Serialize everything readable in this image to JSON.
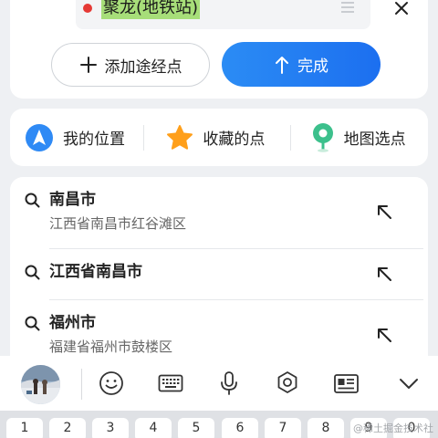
{
  "route": {
    "destination": "聚龙(地铁站)",
    "add_waypoint_label": "添加途经点",
    "done_label": "完成"
  },
  "quick_actions": [
    {
      "label": "我的位置",
      "icon": "location-arrow-icon"
    },
    {
      "label": "收藏的点",
      "icon": "star-icon"
    },
    {
      "label": "地图选点",
      "icon": "map-pin-icon"
    }
  ],
  "results": [
    {
      "title": "南昌市",
      "subtitle": "江西省南昌市红谷滩区"
    },
    {
      "title": "江西省南昌市",
      "subtitle": ""
    },
    {
      "title": "福州市",
      "subtitle": "福建省福州市鼓楼区"
    }
  ],
  "keyboard": {
    "toolbar": [
      "avatar",
      "emoji-icon",
      "keyboard-icon",
      "microphone-icon",
      "settings-icon",
      "clipboard-icon",
      "collapse-chevron-icon"
    ],
    "number_keys": [
      "1",
      "2",
      "3",
      "4",
      "5",
      "6",
      "7",
      "8",
      "9",
      "0"
    ]
  },
  "watermark": "@稀土掘金技术社区",
  "colors": {
    "accent_blue": "#1c6ff0",
    "star_orange": "#ff9f1a",
    "pin_green": "#3cc08c",
    "dot_red": "#e53935",
    "highlight_green": "#a7de79"
  }
}
